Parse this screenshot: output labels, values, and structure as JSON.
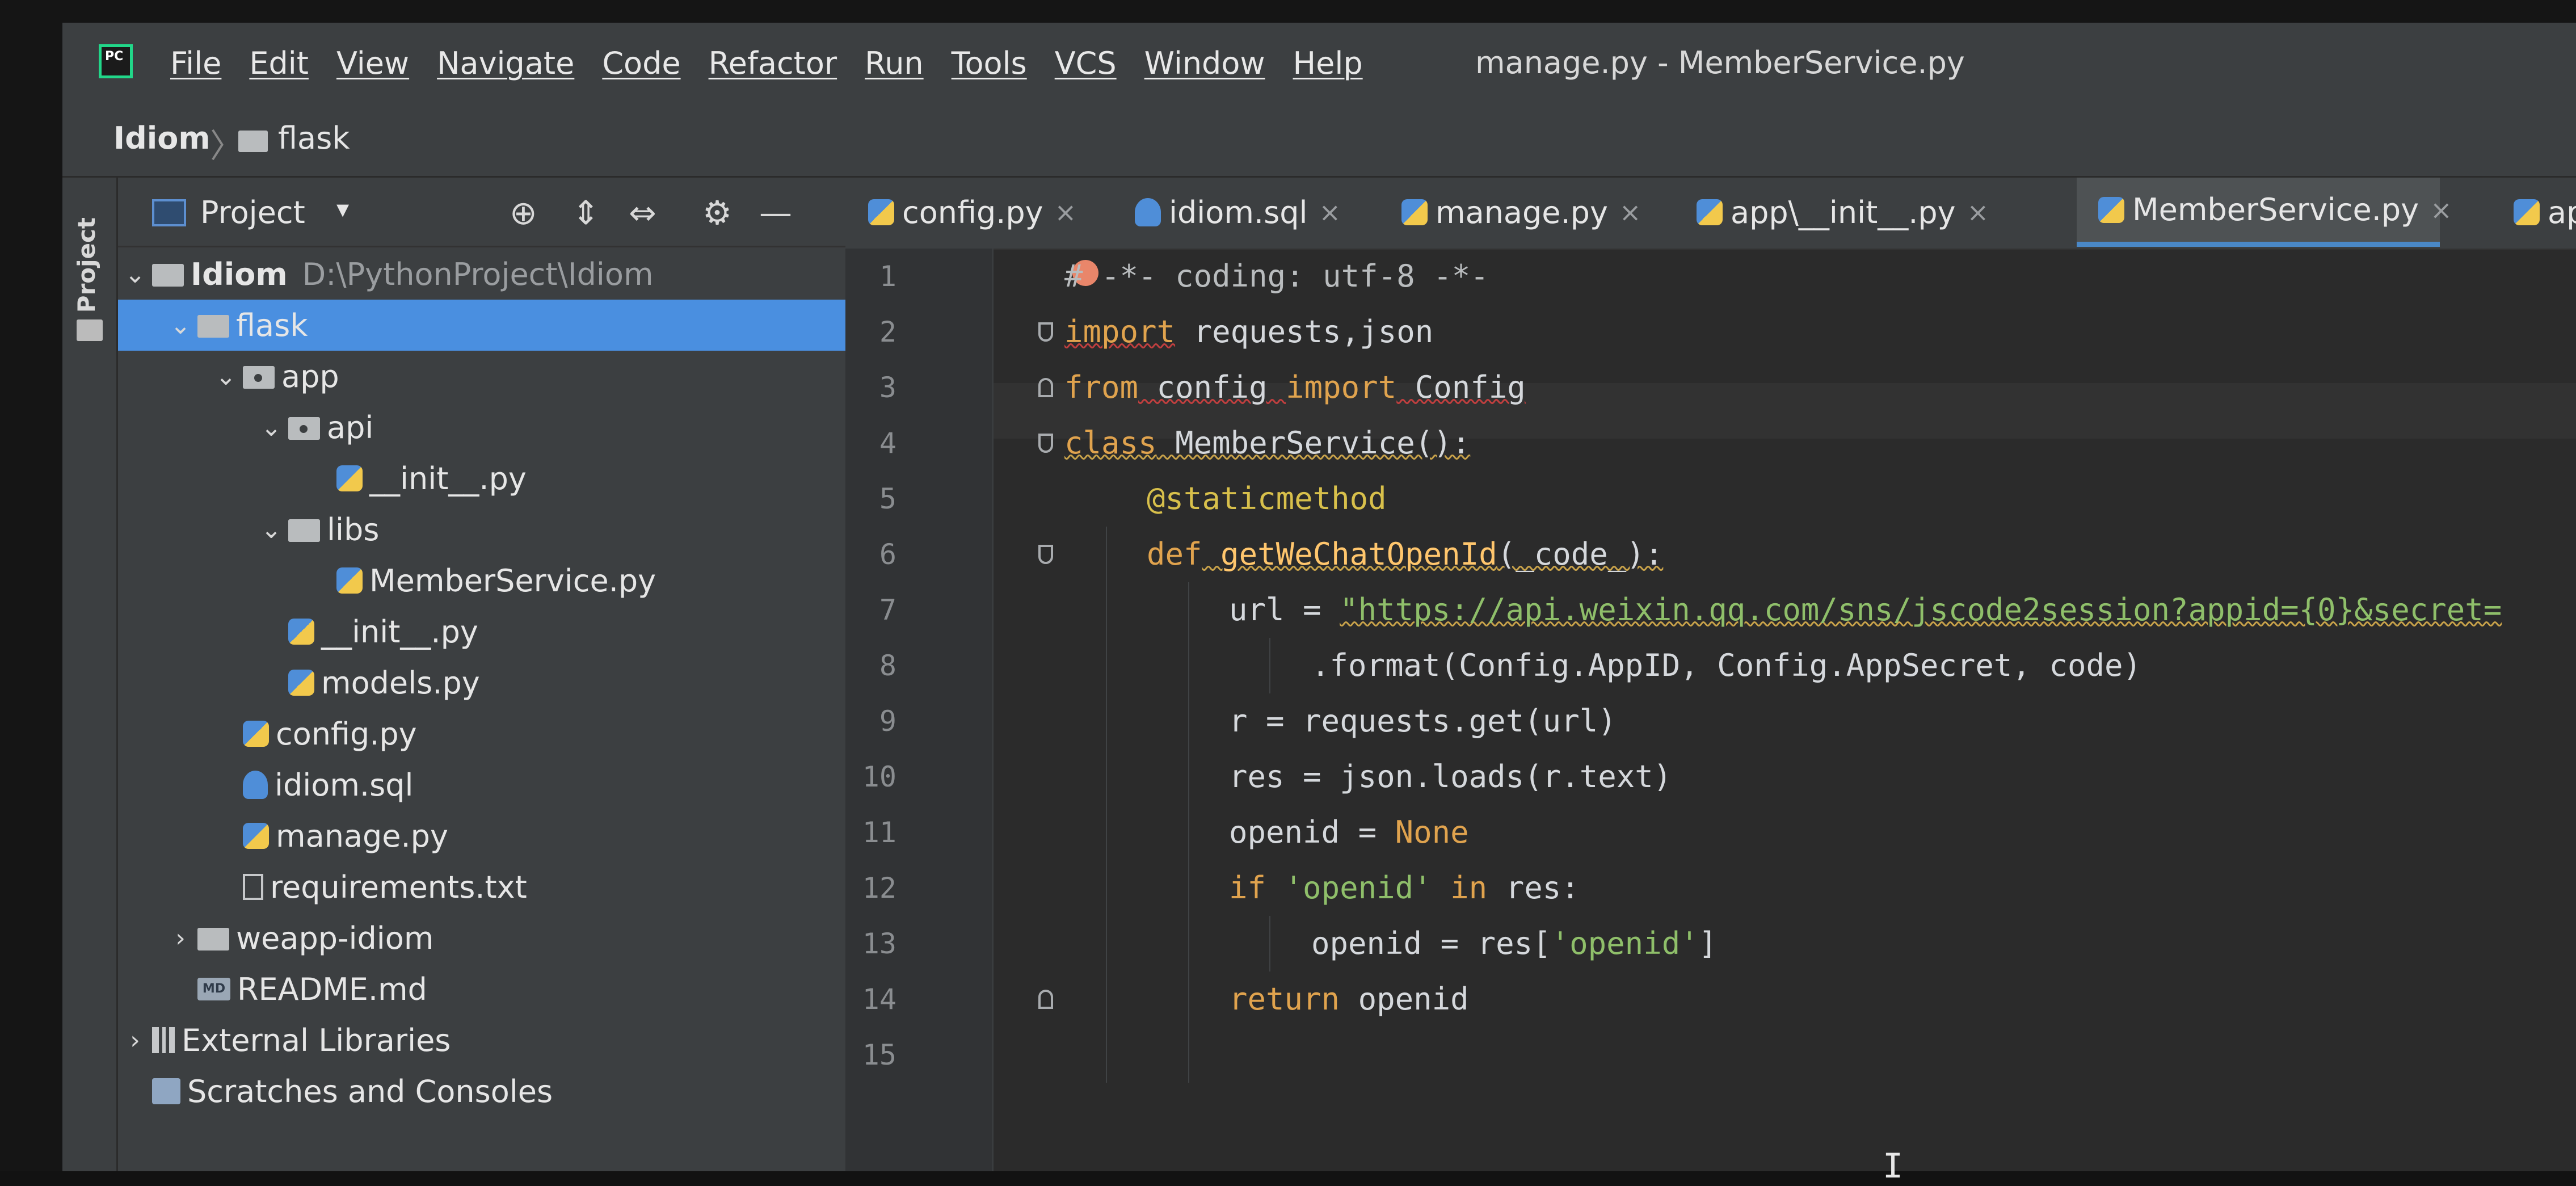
{
  "app": {
    "logo_text": "PC",
    "window_title": "manage.py - MemberService.py"
  },
  "menu": [
    "File",
    "Edit",
    "View",
    "Navigate",
    "Code",
    "Refactor",
    "Run",
    "Tools",
    "VCS",
    "Window",
    "Help"
  ],
  "breadcrumb": {
    "project": "Idiom",
    "separator": "〉",
    "folder": "flask"
  },
  "toolstrip": {
    "label": "Project"
  },
  "project_panel": {
    "title": "Project",
    "dropdown": "▾",
    "icons": {
      "locate": "⊕",
      "expand": "⇕",
      "collapse": "⇔",
      "settings": "⚙",
      "hide": "—"
    },
    "tree": [
      {
        "label": "Idiom",
        "path": "D:\\PythonProject\\Idiom",
        "arrow": "⌄",
        "icon": "folder"
      },
      {
        "label": "flask",
        "arrow": "⌄",
        "icon": "folder"
      },
      {
        "label": "app",
        "arrow": "⌄",
        "icon": "package"
      },
      {
        "label": "api",
        "arrow": "⌄",
        "icon": "package"
      },
      {
        "label": "__init__.py",
        "arrow": "",
        "icon": "python"
      },
      {
        "label": "libs",
        "arrow": "⌄",
        "icon": "folder"
      },
      {
        "label": "MemberService.py",
        "arrow": "",
        "icon": "python"
      },
      {
        "label": "__init__.py",
        "arrow": "",
        "icon": "python"
      },
      {
        "label": "models.py",
        "arrow": "",
        "icon": "python"
      },
      {
        "label": "config.py",
        "arrow": "",
        "icon": "python"
      },
      {
        "label": "idiom.sql",
        "arrow": "",
        "icon": "sql"
      },
      {
        "label": "manage.py",
        "arrow": "",
        "icon": "python"
      },
      {
        "label": "requirements.txt",
        "arrow": "",
        "icon": "text"
      },
      {
        "label": "weapp-idiom",
        "arrow": "›",
        "icon": "folder"
      },
      {
        "label": "README.md",
        "arrow": "",
        "icon": "markdown",
        "badge": "MD"
      },
      {
        "label": "External Libraries",
        "arrow": "›",
        "icon": "library"
      },
      {
        "label": "Scratches and Consoles",
        "arrow": "",
        "icon": "scratch"
      }
    ]
  },
  "tabs": [
    {
      "label": "config.py",
      "close": "×",
      "icon": "python"
    },
    {
      "label": "idiom.sql",
      "close": "×",
      "icon": "sql"
    },
    {
      "label": "manage.py",
      "close": "×",
      "icon": "python"
    },
    {
      "label": "app\\__init__.py",
      "close": "×",
      "icon": "python"
    },
    {
      "label": "MemberService.py",
      "close": "×",
      "icon": "python",
      "active": true
    },
    {
      "label": "api\\_",
      "close": "",
      "icon": "python"
    }
  ],
  "editor": {
    "line_numbers": [
      "1",
      "2",
      "3",
      "4",
      "5",
      "6",
      "7",
      "8",
      "9",
      "10",
      "11",
      "12",
      "13",
      "14",
      "15"
    ],
    "code": {
      "l1": "# -*- coding: utf-8 -*-",
      "l2_kw": "import",
      "l2_rest": " requests,json",
      "l3_kw1": "from",
      "l3_mod": " config ",
      "l3_kw2": "import",
      "l3_rest": " Config",
      "l4_kw": "class",
      "l4_rest": " MemberService():",
      "l5": "@staticmethod",
      "l6_kw": "def",
      "l6_fn": " getWeChatOpenId",
      "l6_rest": "(_code_):",
      "l7_pre": "url = ",
      "l7_str": "\"https://api.weixin.qq.com/sns/jscode2session?appid={0}&secret=",
      "l8": ".format(Config.AppID, Config.AppSecret, code)",
      "l9": "r = requests.get(url)",
      "l10": "res = json.loads(r.text)",
      "l11_pre": "openid = ",
      "l11_kw": "None",
      "l12_kw1": "if",
      "l12_str": " 'openid'",
      "l12_kw2": " in",
      "l12_rest": " res:",
      "l13_pre": "openid = res[",
      "l13_str": "'openid'",
      "l13_post": "]",
      "l14_kw": "return",
      "l14_rest": " openid"
    }
  },
  "mouse_cursor": "I",
  "colors": {
    "selection": "#4a8fe0",
    "keyword": "#e0a34e",
    "string": "#8fbf6a",
    "decorator": "#d8c04b",
    "function": "#ffc66d",
    "editor_bg": "#2b2b2b",
    "panel_bg": "#3c3f41"
  }
}
